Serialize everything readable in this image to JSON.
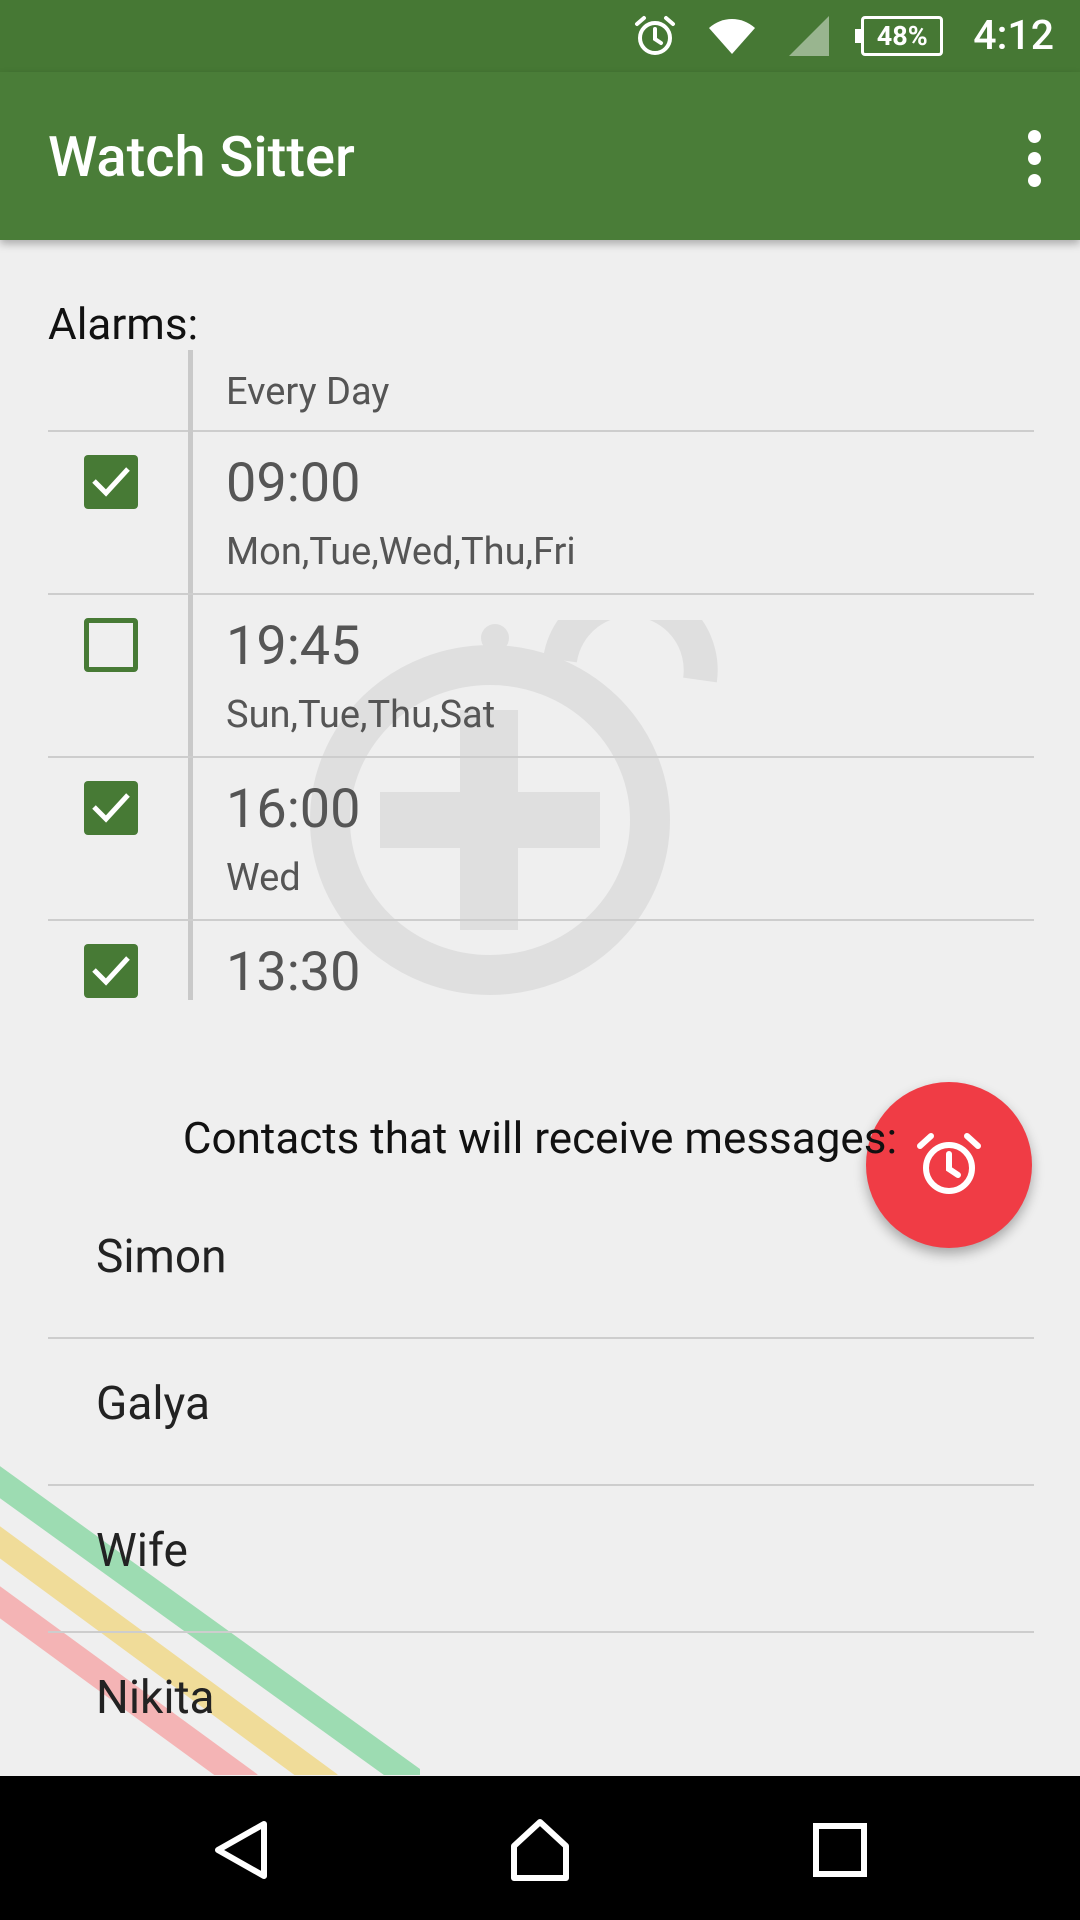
{
  "status_bar": {
    "battery": "48%",
    "time": "4:12"
  },
  "app_bar": {
    "title": "Watch Sitter"
  },
  "alarms": {
    "label": "Alarms:",
    "header": "Every Day",
    "items": [
      {
        "time": "09:00",
        "days": "Mon,Tue,Wed,Thu,Fri",
        "checked": true
      },
      {
        "time": "19:45",
        "days": "Sun,Tue,Thu,Sat",
        "checked": false
      },
      {
        "time": "16:00",
        "days": "Wed",
        "checked": true
      },
      {
        "time": "13:30",
        "days": "",
        "checked": true
      }
    ]
  },
  "contacts": {
    "label": "Contacts that will receive messages:",
    "items": [
      "Simon",
      "Galya",
      "Wife",
      "Nikita"
    ]
  },
  "colors": {
    "primary": "#4a7d38",
    "accent": "#f03c45"
  },
  "icons": {
    "status": [
      "alarm-icon",
      "wifi-icon",
      "signal-icon",
      "battery-icon"
    ],
    "fab_alarm": "alarm-clock-icon",
    "fab_contact": "person-icon",
    "nav": [
      "back-icon",
      "home-icon",
      "recents-icon"
    ]
  }
}
